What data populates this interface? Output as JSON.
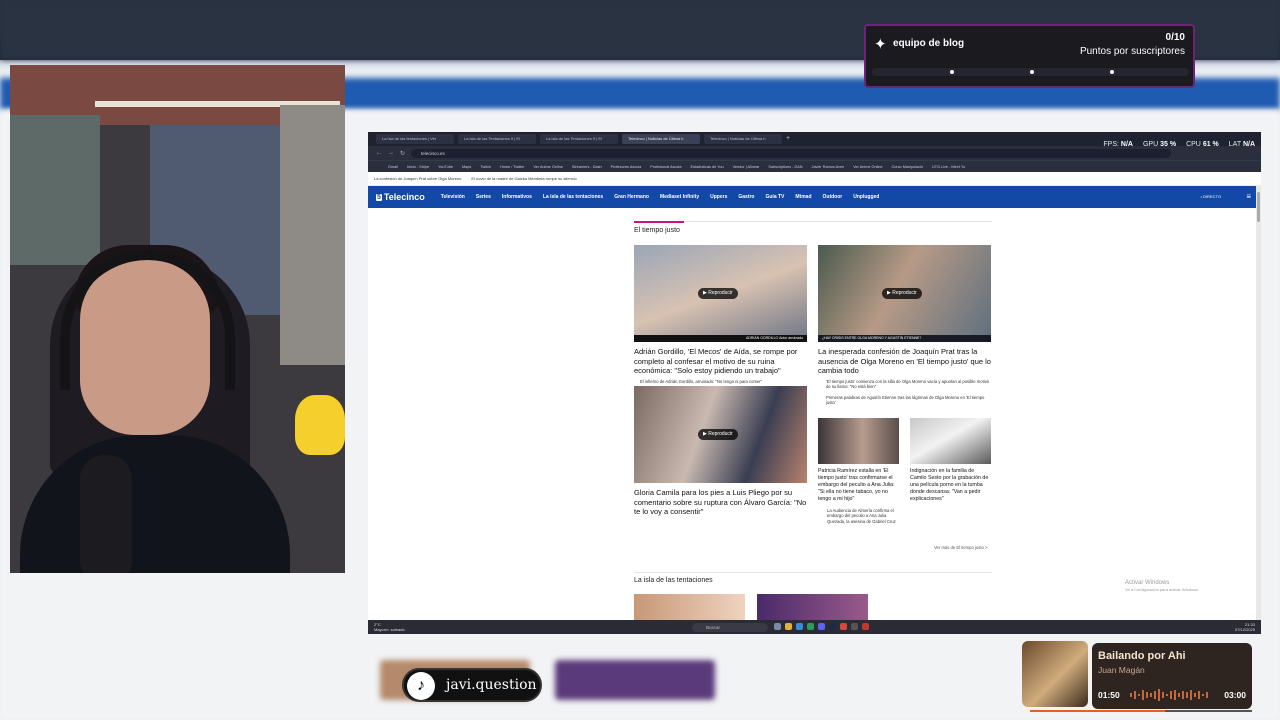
{
  "goal_widget": {
    "title": "equipo de blog",
    "count": "0/10",
    "subtitle": "Puntos por suscriptores",
    "progress": 0,
    "icon": "star-badge-icon"
  },
  "browser": {
    "tabs": [
      "La isla de las tentaciones | Ver",
      "La isla de las Tentaciones 9 | El",
      "La isla de las Tentaciones 9 | El",
      "Telecinco | Noticias de Última h",
      "Telecinco | Noticias de Última h"
    ],
    "active_tab_index": 3,
    "perf": {
      "fps_label": "FPS:",
      "fps": "N/A",
      "gpu_label": "GPU",
      "gpu": "35 %",
      "cpu_label": "CPU",
      "cpu": "61 %",
      "lat_label": "LAT",
      "lat": "N/A"
    },
    "url": "telecinco.es",
    "bookmarks": [
      "Gmail",
      "Inicio - Stripe",
      "YouTube",
      "Maps",
      "Twitch",
      "Home / Twitter",
      "Ver Anime Online",
      "Streamers - Dash",
      "Profesores Asocia",
      "Profesional Asocia",
      "Estadísticas de You",
      "Vendor | Alinear",
      "Subscriptions - DAN",
      "Javier Ramos Aven",
      "Ver Anime Online",
      "Curso Manipulació",
      "UTG.Live - Meet Yo"
    ],
    "notice_items": [
      "La confesión de Joaquín Prat sobre Olga Moreno",
      "El novio de la madre de Gaizka Mendieta rompe su silencio"
    ],
    "nav": {
      "logo": "Telecinco",
      "items": [
        "Televisión",
        "Series",
        "Informativos",
        "La isla de las tentaciones",
        "Gran Hermano",
        "Mediaset Infinity",
        "Uppers",
        "Gastro",
        "Guía TV",
        "Mtmad",
        "Outdoor",
        "Unplugged"
      ],
      "directo": "• DIRECTO"
    }
  },
  "content": {
    "section1_title": "El tiempo justo",
    "card1": {
      "headline": "Adrián Gordillo, 'El Mecos' de Aída, se rompe por completo al confesar el motivo de su ruina económica: \"Solo estoy pidiendo un trabajo\"",
      "play": "Reproducir",
      "related": "El infierno de Adrián Gordillo, arruinado: \"No tengo ni para comer\"",
      "caption": "ADRIÁN GORDILLO Actor arruinado"
    },
    "card2": {
      "headline": "La inesperada confesión de Joaquín Prat tras la ausencia de Olga Moreno en 'El tiempo justo' que lo cambia todo",
      "play": "Reproducir",
      "related": [
        "'El tiempo justo' comienza con la silla de Olga Moreno vacía y apuntan al posible motivo de su llamo: \"No está bien\"",
        "Primeras palabras de Agustín Etienne tras las lágrimas de Olga Moreno en 'El tiempo justo'"
      ],
      "caption": "¿HAY CRISIS ENTRE OLGA MORENO Y AGUSTÍN ETIENNE?"
    },
    "card3": {
      "headline": "Gloria Camila para los pies a Luis Pliego por su comentario sobre su ruptura con Álvaro García: \"No te lo voy a consentir\"",
      "play": "Reproducir"
    },
    "card4": {
      "headline": "Patricia Ramírez estalla en 'El tiempo justo' tras confirmarse el embargo del peculio a Ana Julia: \"Si ella no tiene tabaco, yo no tengo a mi hijo\"",
      "related": "La Audiencia de Almería confirma el embargo del peculio a Ana Julia Quezada, la asesina de Gabriel Cruz"
    },
    "card5": {
      "headline": "Indignación en la familia de Camilo Sesto por la grabación de una película porno en la tumba donde descansa: \"Van a pedir explicaciones\""
    },
    "see_more": "Ver más de El tiempo justo >",
    "section2_title": "La isla de las tentaciones",
    "activate_windows": [
      "Activar Windows",
      "Ve a Configuración para activar Windows."
    ]
  },
  "taskbar": {
    "weather": [
      "2°C",
      "Mayorm. soleado"
    ],
    "search_placeholder": "Buscar",
    "clock": [
      "21:33",
      "07/12/2025"
    ],
    "lang": "ESP"
  },
  "tiktok": {
    "handle": "javi.question"
  },
  "music": {
    "title": "Bailando por Ahi",
    "artist": "Juan Magán",
    "current": "01:50",
    "duration": "03:00",
    "progress": 0.61
  },
  "colors": {
    "telecinco_blue": "#1349a6",
    "accent_pink": "#c8147c",
    "goal_border": "#6c2378",
    "music_accent": "#e85d2a"
  }
}
